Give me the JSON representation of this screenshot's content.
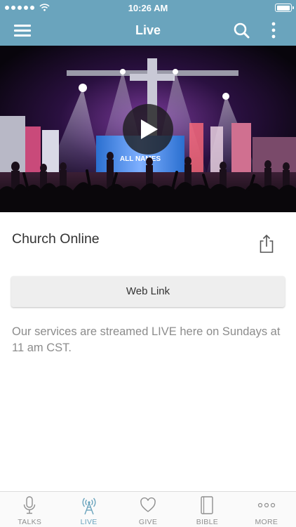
{
  "status_bar": {
    "time": "10:26 AM"
  },
  "nav": {
    "title": "Live"
  },
  "video": {
    "screen_text": "ALL NAMES"
  },
  "content": {
    "title": "Church Online",
    "web_link_label": "Web Link",
    "description": "Our services are streamed LIVE here on Sundays at 11 am CST."
  },
  "tabs": [
    {
      "label": "TALKS",
      "icon": "microphone-icon",
      "active": false
    },
    {
      "label": "LIVE",
      "icon": "broadcast-tower-icon",
      "active": true
    },
    {
      "label": "GIVE",
      "icon": "heart-icon",
      "active": false
    },
    {
      "label": "BIBLE",
      "icon": "book-icon",
      "active": false
    },
    {
      "label": "MORE",
      "icon": "ellipsis-icon",
      "active": false
    }
  ],
  "colors": {
    "accent": "#6aa4bd",
    "inactive_tab": "#8f8f8f",
    "description_text": "#8c8c8c",
    "button_bg": "#eeeeee"
  },
  "battery_level": 0.95
}
